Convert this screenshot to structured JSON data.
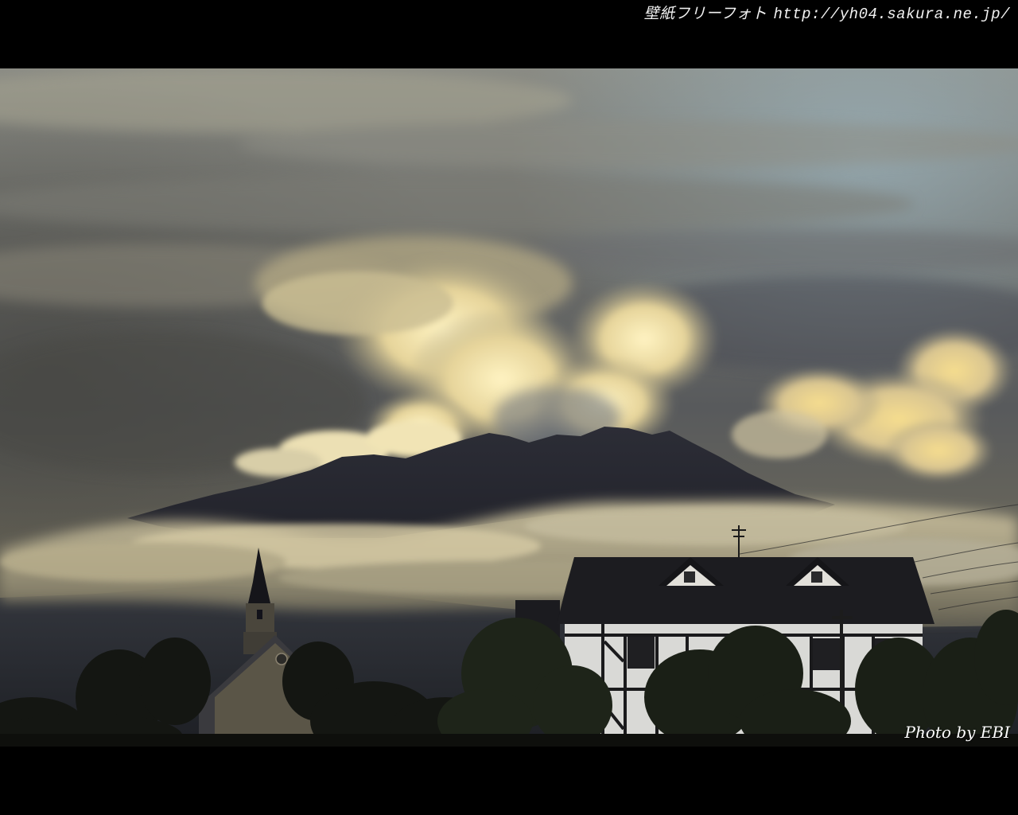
{
  "header": {
    "site_name": "壁紙フリーフォト",
    "url": "http://yh04.sakura.ne.jp/"
  },
  "photo": {
    "subject": "volcano-landscape",
    "credit": "Photo by EBI"
  },
  "colors": {
    "letterbox": "#000000",
    "sky_dark": "#4a4c4e",
    "cloud_highlight": "#f4e4a6",
    "mountain": "#2a2c36"
  }
}
